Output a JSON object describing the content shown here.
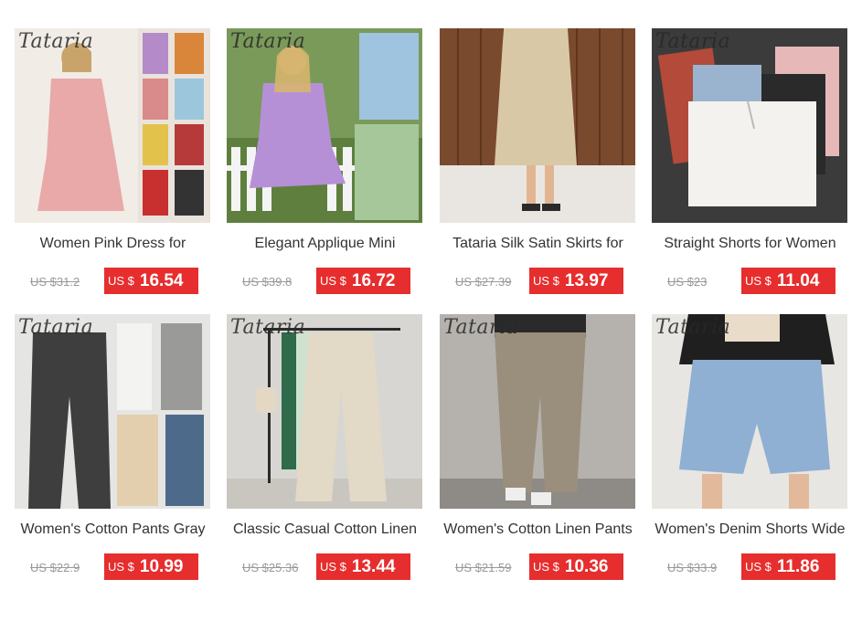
{
  "brand_watermark": "Tataria",
  "colors": {
    "price_badge_bg": "#e62e2e",
    "title_text": "#333333",
    "old_price_text": "#999999"
  },
  "products": [
    {
      "title": "Women Pink Dress for",
      "old_price": "US $31.2",
      "currency": "US $",
      "price": "16.54",
      "watermark": true,
      "image": "pink-dress-image"
    },
    {
      "title": "Elegant Applique Mini",
      "old_price": "US $39.8",
      "currency": "US $",
      "price": "16.72",
      "watermark": true,
      "image": "lilac-mini-dress-image"
    },
    {
      "title": "Tataria Silk Satin Skirts for",
      "old_price": "US $27.39",
      "currency": "US $",
      "price": "13.97",
      "watermark": false,
      "image": "satin-skirt-image"
    },
    {
      "title": "Straight Shorts for Women",
      "old_price": "US $23",
      "currency": "US $",
      "price": "11.04",
      "watermark": true,
      "image": "linen-shorts-image"
    },
    {
      "title": "Women's Cotton Pants Gray",
      "old_price": "US $22.9",
      "currency": "US $",
      "price": "10.99",
      "watermark": true,
      "image": "cotton-pants-image"
    },
    {
      "title": "Classic Casual Cotton Linen",
      "old_price": "US $25.36",
      "currency": "US $",
      "price": "13.44",
      "watermark": true,
      "image": "wide-leg-pants-image"
    },
    {
      "title": "Women's Cotton Linen Pants",
      "old_price": "US $21.59",
      "currency": "US $",
      "price": "10.36",
      "watermark": true,
      "image": "khaki-pants-image"
    },
    {
      "title": "Women's Denim Shorts Wide",
      "old_price": "US $33.9",
      "currency": "US $",
      "price": "11.86",
      "watermark": true,
      "image": "denim-shorts-image"
    }
  ]
}
